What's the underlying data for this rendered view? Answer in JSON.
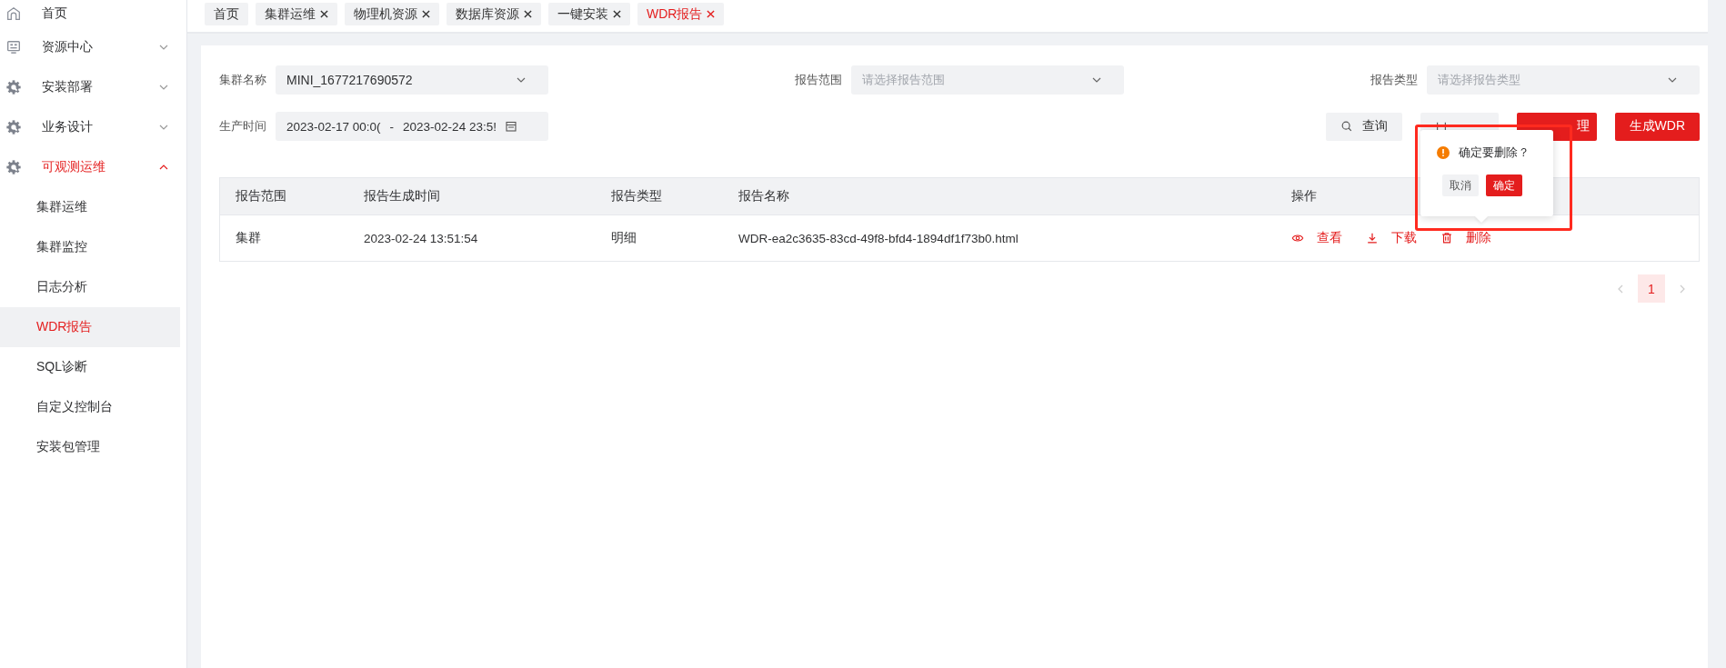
{
  "sidebar": {
    "items": [
      {
        "label": "首页",
        "kind": "home",
        "selected": false
      },
      {
        "label": "资源中心",
        "kind": "monitor",
        "selected": false,
        "expanded": false
      },
      {
        "label": "安装部署",
        "kind": "gear",
        "selected": false,
        "expanded": false
      },
      {
        "label": "业务设计",
        "kind": "gear",
        "selected": false,
        "expanded": false
      },
      {
        "label": "可观测运维",
        "kind": "gear",
        "selected": true,
        "expanded": true,
        "children": [
          {
            "label": "集群运维",
            "selected": false
          },
          {
            "label": "集群监控",
            "selected": false
          },
          {
            "label": "日志分析",
            "selected": false
          },
          {
            "label": "WDR报告",
            "selected": true
          },
          {
            "label": "SQL诊断",
            "selected": false
          },
          {
            "label": "自定义控制台",
            "selected": false
          },
          {
            "label": "安装包管理",
            "selected": false
          }
        ]
      }
    ]
  },
  "tabs": [
    {
      "label": "首页",
      "closable": false,
      "selected": false
    },
    {
      "label": "集群运维",
      "closable": true,
      "selected": false
    },
    {
      "label": "物理机资源",
      "closable": true,
      "selected": false
    },
    {
      "label": "数据库资源",
      "closable": true,
      "selected": false
    },
    {
      "label": "一键安装",
      "closable": true,
      "selected": false
    },
    {
      "label": "WDR报告",
      "closable": true,
      "selected": true
    }
  ],
  "filters": [
    {
      "label": "集群名称",
      "value": "MINI_1677217690572"
    },
    {
      "label": "报告范围",
      "placeholder": "请选择报告范围"
    },
    {
      "label": "报告类型",
      "placeholder": "请选择报告类型"
    }
  ],
  "time_range": {
    "label": "生产时间",
    "start": "2023-02-17 00:0(",
    "separator": "-",
    "end": "2023-02-24 23:5!"
  },
  "buttons": [
    {
      "label": "查询",
      "kind": "search"
    },
    {
      "kind": "reset"
    },
    {
      "label": "理",
      "kind": "partial"
    },
    {
      "label": "生成WDR",
      "kind": "primary"
    }
  ],
  "table": {
    "columns": [
      "报告范围",
      "报告生成时间",
      "报告类型",
      "报告名称",
      "操作"
    ],
    "rows": [
      {
        "cells": [
          "集群",
          "2023-02-24 13:51:54",
          "明细",
          "WDR-ea2c3635-83cd-49f8-bfd4-1894df1f73b0.html"
        ],
        "actions": [
          {
            "label": "查看",
            "kind": "view"
          },
          {
            "label": "下载",
            "kind": "download"
          },
          {
            "label": "删除",
            "kind": "delete"
          }
        ]
      }
    ]
  },
  "pagination": {
    "pages": [
      {
        "label": "1",
        "selected": true
      }
    ]
  },
  "popconfirm": {
    "message": "确定要删除？",
    "buttons": [
      {
        "label": "取消",
        "kind": "default"
      },
      {
        "label": "确定",
        "kind": "primary"
      }
    ]
  }
}
